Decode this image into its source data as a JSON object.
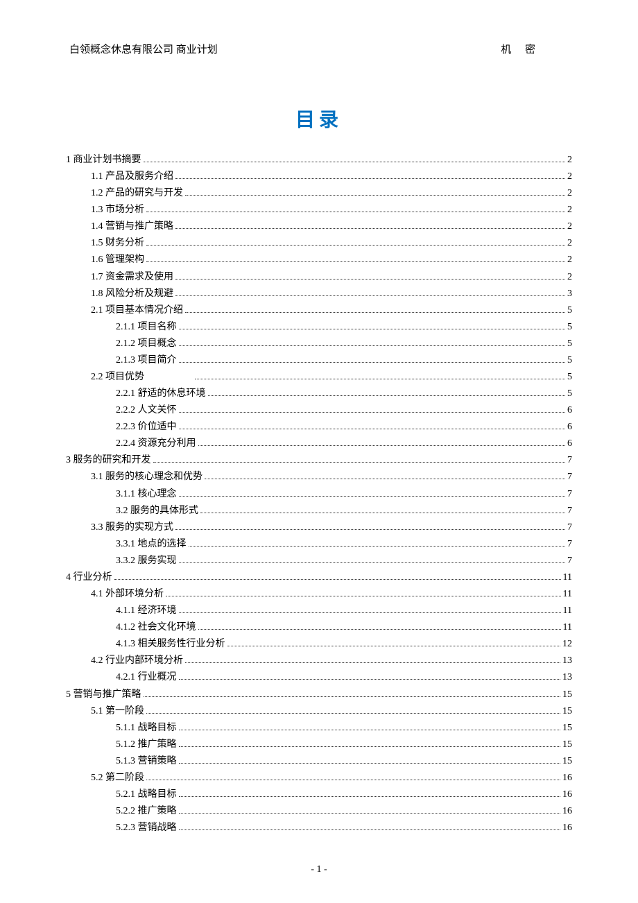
{
  "header": {
    "left": "白领概念休息有限公司  商业计划",
    "right": "机 密"
  },
  "title": "目录",
  "pageNumber": "- 1 -",
  "toc": [
    {
      "level": 0,
      "label": "1 商业计划书摘要",
      "page": "2"
    },
    {
      "level": 1,
      "label": "1.1 产品及服务介绍",
      "page": "2"
    },
    {
      "level": 1,
      "label": "1.2 产品的研究与开发",
      "page": "2"
    },
    {
      "level": 1,
      "label": "1.3 市场分析",
      "page": "2"
    },
    {
      "level": 1,
      "label": "1.4 营销与推广策略",
      "page": "2"
    },
    {
      "level": 1,
      "label": "1.5 财务分析",
      "page": "2"
    },
    {
      "level": 1,
      "label": "1.6 管理架构",
      "page": "2"
    },
    {
      "level": 1,
      "label": "1.7 资金需求及使用",
      "page": "2"
    },
    {
      "level": 1,
      "label": "1.8 风险分析及规避",
      "page": "3"
    },
    {
      "level": 1,
      "label": "2.1 项目基本情况介绍",
      "page": "5"
    },
    {
      "level": 2,
      "label": "2.1.1 项目名称",
      "page": "5"
    },
    {
      "level": 2,
      "label": "2.1.2 项目概念",
      "page": "5"
    },
    {
      "level": 2,
      "label": "2.1.3 项目简介",
      "page": "5"
    },
    {
      "level": 1,
      "label": "2.2 项目优势　　　　　",
      "page": "5"
    },
    {
      "level": 2,
      "label": "2.2.1 舒适的休息环境",
      "page": "5"
    },
    {
      "level": 2,
      "label": "2.2.2 人文关怀",
      "page": "6"
    },
    {
      "level": 2,
      "label": "2.2.3 价位适中",
      "page": "6"
    },
    {
      "level": 2,
      "label": "2.2.4 资源充分利用",
      "page": "6"
    },
    {
      "level": 0,
      "label": "3 服务的研究和开发",
      "page": "7"
    },
    {
      "level": 1,
      "label": "3.1 服务的核心理念和优势",
      "page": "7"
    },
    {
      "level": 2,
      "label": "3.1.1 核心理念",
      "page": "7"
    },
    {
      "level": 2,
      "label": "3.2 服务的具体形式",
      "page": "7"
    },
    {
      "level": 1,
      "label": "3.3 服务的实现方式",
      "page": "7"
    },
    {
      "level": 2,
      "label": "3.3.1 地点的选择",
      "page": "7"
    },
    {
      "level": 2,
      "label": "3.3.2 服务实现",
      "page": "7"
    },
    {
      "level": 0,
      "label": "4 行业分析",
      "page": "11"
    },
    {
      "level": 1,
      "label": "4.1 外部环境分析",
      "page": "11"
    },
    {
      "level": 2,
      "label": "4.1.1 经济环境",
      "page": "11"
    },
    {
      "level": 2,
      "label": "4.1.2 社会文化环境",
      "page": "11"
    },
    {
      "level": 2,
      "label": "4.1.3 相关服务性行业分析",
      "page": "12"
    },
    {
      "level": 1,
      "label": "4.2 行业内部环境分析",
      "page": "13"
    },
    {
      "level": 2,
      "label": "4.2.1 行业概况",
      "page": "13"
    },
    {
      "level": 0,
      "label": "5 营销与推广策略",
      "page": "15"
    },
    {
      "level": 1,
      "label": "5.1 第一阶段",
      "page": "15"
    },
    {
      "level": 2,
      "label": "5.1.1 战略目标",
      "page": "15"
    },
    {
      "level": 2,
      "label": "5.1.2 推广策略",
      "page": "15"
    },
    {
      "level": 2,
      "label": "5.1.3 营销策略",
      "page": "15"
    },
    {
      "level": 1,
      "label": "5.2 第二阶段",
      "page": "16"
    },
    {
      "level": 2,
      "label": "5.2.1 战略目标",
      "page": "16"
    },
    {
      "level": 2,
      "label": "5.2.2 推广策略",
      "page": "16"
    },
    {
      "level": 2,
      "label": "5.2.3 营销战略",
      "page": "16"
    }
  ]
}
